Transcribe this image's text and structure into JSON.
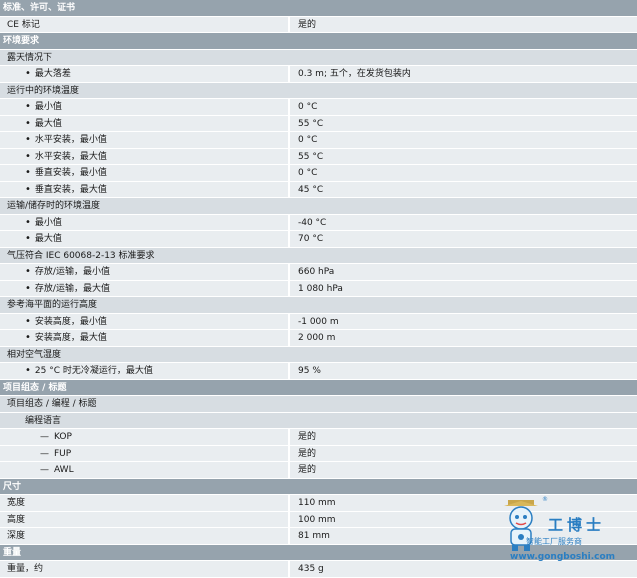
{
  "sections": {
    "standards": {
      "title": "标准、许可、证书",
      "ce_label": "CE 标记",
      "ce_value": "是的"
    },
    "environment": {
      "title": "环境要求",
      "outdoor": {
        "title": "露天情况下",
        "max_drop_label": "最大落差",
        "max_drop_value": "0.3 m; 五个，在发货包装内"
      },
      "operating_temp": {
        "title": "运行中的环境温度",
        "rows": [
          {
            "label": "最小值",
            "value": "0 °C"
          },
          {
            "label": "最大值",
            "value": "55 °C"
          },
          {
            "label": "水平安装，最小值",
            "value": "0 °C"
          },
          {
            "label": "水平安装，最大值",
            "value": "55 °C"
          },
          {
            "label": "垂直安装，最小值",
            "value": "0 °C"
          },
          {
            "label": "垂直安装，最大值",
            "value": "45 °C"
          }
        ]
      },
      "transport_temp": {
        "title": "运输/储存时的环境温度",
        "rows": [
          {
            "label": "最小值",
            "value": "-40 °C"
          },
          {
            "label": "最大值",
            "value": "70 °C"
          }
        ]
      },
      "air_pressure": {
        "title": "气压符合 IEC 60068-2-13 标准要求",
        "rows": [
          {
            "label": "存放/运输，最小值",
            "value": "660 hPa"
          },
          {
            "label": "存放/运输，最大值",
            "value": "1 080 hPa"
          }
        ]
      },
      "altitude": {
        "title": "参考海平面的运行高度",
        "rows": [
          {
            "label": "安装高度，最小值",
            "value": "-1 000 m"
          },
          {
            "label": "安装高度，最大值",
            "value": "2 000 m"
          }
        ]
      },
      "humidity": {
        "title": "相对空气湿度",
        "row_label": "25 °C 时无冷凝运行，最大值",
        "row_value": "95 %"
      }
    },
    "project": {
      "title": "项目组态 / 标题",
      "sub_title": "项目组态 / 编程 / 标题",
      "lang_title": "编程语言",
      "langs": [
        {
          "label": "KOP",
          "value": "是的"
        },
        {
          "label": "FUP",
          "value": "是的"
        },
        {
          "label": "AWL",
          "value": "是的"
        }
      ]
    },
    "dimensions": {
      "title": "尺寸",
      "rows": [
        {
          "label": "宽度",
          "value": "110 mm"
        },
        {
          "label": "高度",
          "value": "100 mm"
        },
        {
          "label": "深度",
          "value": "81 mm"
        }
      ]
    },
    "weight": {
      "title": "重量",
      "label": "重量，约",
      "value": "435 g"
    }
  },
  "watermark": {
    "brand": "工博士",
    "tagline": "智能工厂服务商",
    "url": "www.gongboshi.com",
    "registered": "®",
    "accent_color": "#2a7ec2",
    "icon": "robot-mascot-logo"
  },
  "colors": {
    "section_header_bg": "#96a3ad",
    "subheader_bg": "#d7dde2",
    "data_row_bg": "#e9edf0"
  }
}
